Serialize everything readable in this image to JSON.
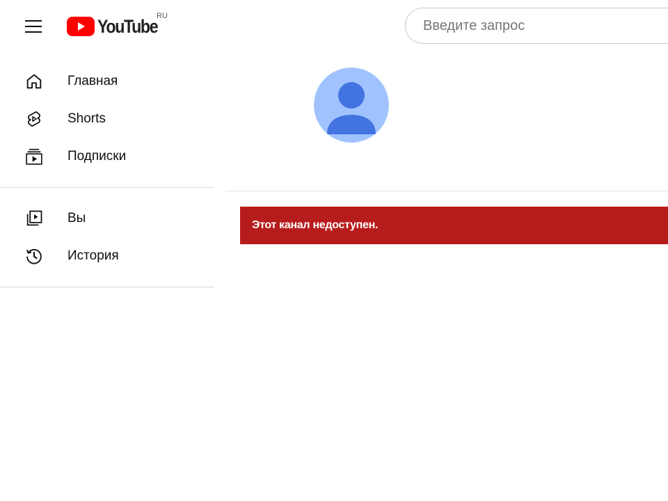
{
  "header": {
    "logo_text": "YouTube",
    "logo_region": "RU",
    "search_placeholder": "Введите запрос",
    "search_value": "",
    "brand_color": "#ff0000"
  },
  "sidebar": {
    "items": [
      {
        "label": "Главная",
        "icon": "home-icon"
      },
      {
        "label": "Shorts",
        "icon": "shorts-icon"
      },
      {
        "label": "Подписки",
        "icon": "subscriptions-icon"
      },
      {
        "label": "Вы",
        "icon": "you-library-icon"
      },
      {
        "label": "История",
        "icon": "history-icon"
      }
    ]
  },
  "main": {
    "avatar_icon": "default-avatar-icon",
    "alert_text": "Этот канал недоступен.",
    "alert_color": "#b71c1c"
  }
}
